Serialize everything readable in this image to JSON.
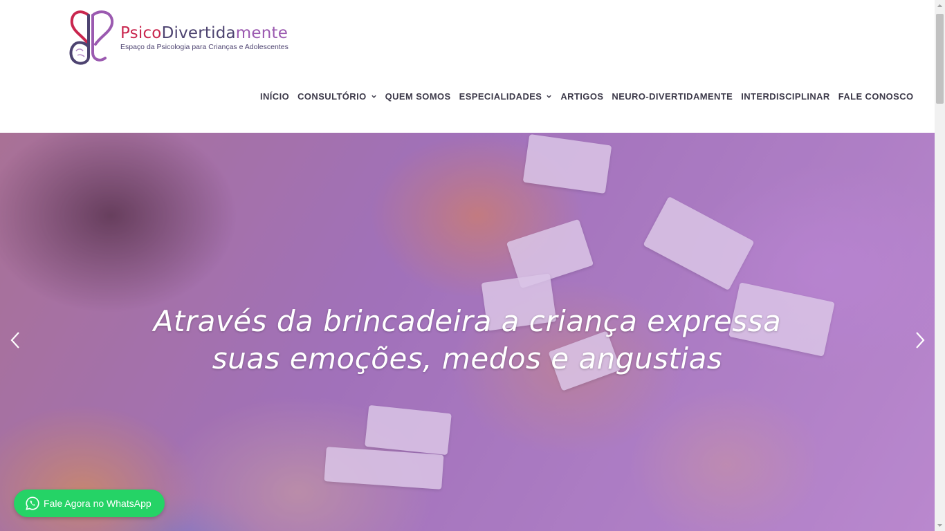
{
  "logo": {
    "name_part1": "Psico",
    "name_part2": "Divertida",
    "name_part3": "mente",
    "tagline": "Espaço da Psicologia para Crianças e Adolescentes"
  },
  "nav": {
    "items": [
      {
        "label": "INÍCIO",
        "dropdown": false
      },
      {
        "label": "CONSULTÓRIO",
        "dropdown": true
      },
      {
        "label": "QUEM SOMOS",
        "dropdown": false
      },
      {
        "label": "ESPECIALIDADES",
        "dropdown": true
      },
      {
        "label": "ARTIGOS",
        "dropdown": false
      },
      {
        "label": "NEURO-DIVERTIDAMENTE",
        "dropdown": false
      },
      {
        "label": "INTERDISCIPLINAR",
        "dropdown": false
      },
      {
        "label": "FALE CONOSCO",
        "dropdown": false
      }
    ]
  },
  "hero": {
    "line1": "Através da brincadeira a criança expressa",
    "line2": "suas emoções, medos e angustias",
    "prev_icon": "chevron-left-icon",
    "next_icon": "chevron-right-icon"
  },
  "whatsapp": {
    "label": "Fale Agora no WhatsApp",
    "icon": "whatsapp-icon",
    "color": "#25d366"
  },
  "colors": {
    "brand_red": "#c9264e",
    "brand_navy": "#4d4370",
    "brand_purple": "#9b5ab0"
  }
}
